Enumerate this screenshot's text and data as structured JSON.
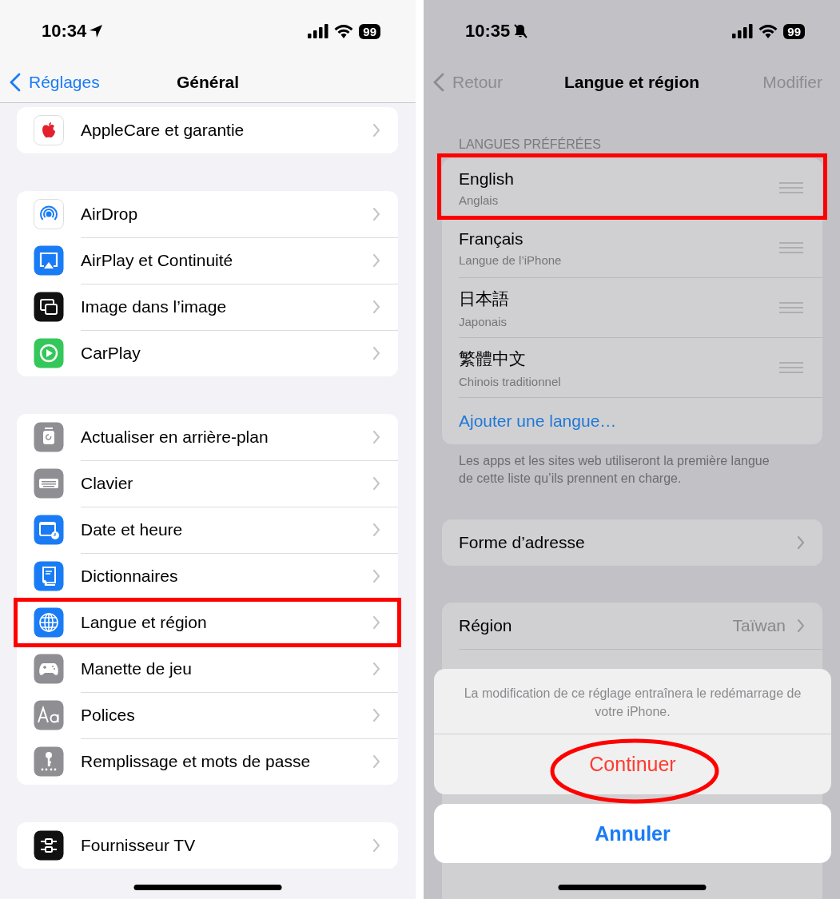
{
  "left_screen": {
    "status_bar": {
      "time": "10:34",
      "battery": "99"
    },
    "nav": {
      "back": "Réglages",
      "title": "Général"
    },
    "groups": [
      [
        {
          "label": "AppleCare et garantie",
          "highlighted": false
        }
      ],
      [
        {
          "label": "AirDrop",
          "highlighted": false
        },
        {
          "label": "AirPlay et Continuité",
          "highlighted": false
        },
        {
          "label": "Image dans l’image",
          "highlighted": false
        },
        {
          "label": "CarPlay",
          "highlighted": false
        }
      ],
      [
        {
          "label": "Actualiser en arrière-plan",
          "highlighted": false
        },
        {
          "label": "Clavier",
          "highlighted": false
        },
        {
          "label": "Date et heure",
          "highlighted": false
        },
        {
          "label": "Dictionnaires",
          "highlighted": false
        },
        {
          "label": "Langue et région",
          "highlighted": true
        },
        {
          "label": "Manette de jeu",
          "highlighted": false
        },
        {
          "label": "Polices",
          "highlighted": false
        },
        {
          "label": "Remplissage et mots de passe",
          "highlighted": false
        }
      ],
      [
        {
          "label": "Fournisseur TV",
          "highlighted": false
        }
      ]
    ]
  },
  "right_screen": {
    "status_bar": {
      "time": "10:35",
      "battery": "99"
    },
    "nav": {
      "back": "Retour",
      "title": "Langue et région",
      "action": "Modifier"
    },
    "languages_header": "LANGUES PRÉFÉRÉES",
    "languages": [
      {
        "name": "English",
        "subtitle": "Anglais",
        "highlighted": true
      },
      {
        "name": "Français",
        "subtitle": "Langue de l’iPhone",
        "highlighted": false
      },
      {
        "name": "日本語",
        "subtitle": "Japonais",
        "highlighted": false
      },
      {
        "name": "繁體中文",
        "subtitle": "Chinois traditionnel",
        "highlighted": false
      }
    ],
    "add_language": "Ajouter une langue…",
    "languages_footer": "Les apps et les sites web utiliseront la première langue de cette liste qu’ils prennent en charge.",
    "address_form": "Forme d’adresse",
    "region_rows": [
      {
        "label": "Région",
        "value": "Taïwan"
      }
    ],
    "action_sheet": {
      "message": "La modification de ce réglage entraînera le redémarrage de votre iPhone.",
      "confirm": "Continuer",
      "confirm_highlighted": true,
      "cancel": "Annuler"
    }
  }
}
